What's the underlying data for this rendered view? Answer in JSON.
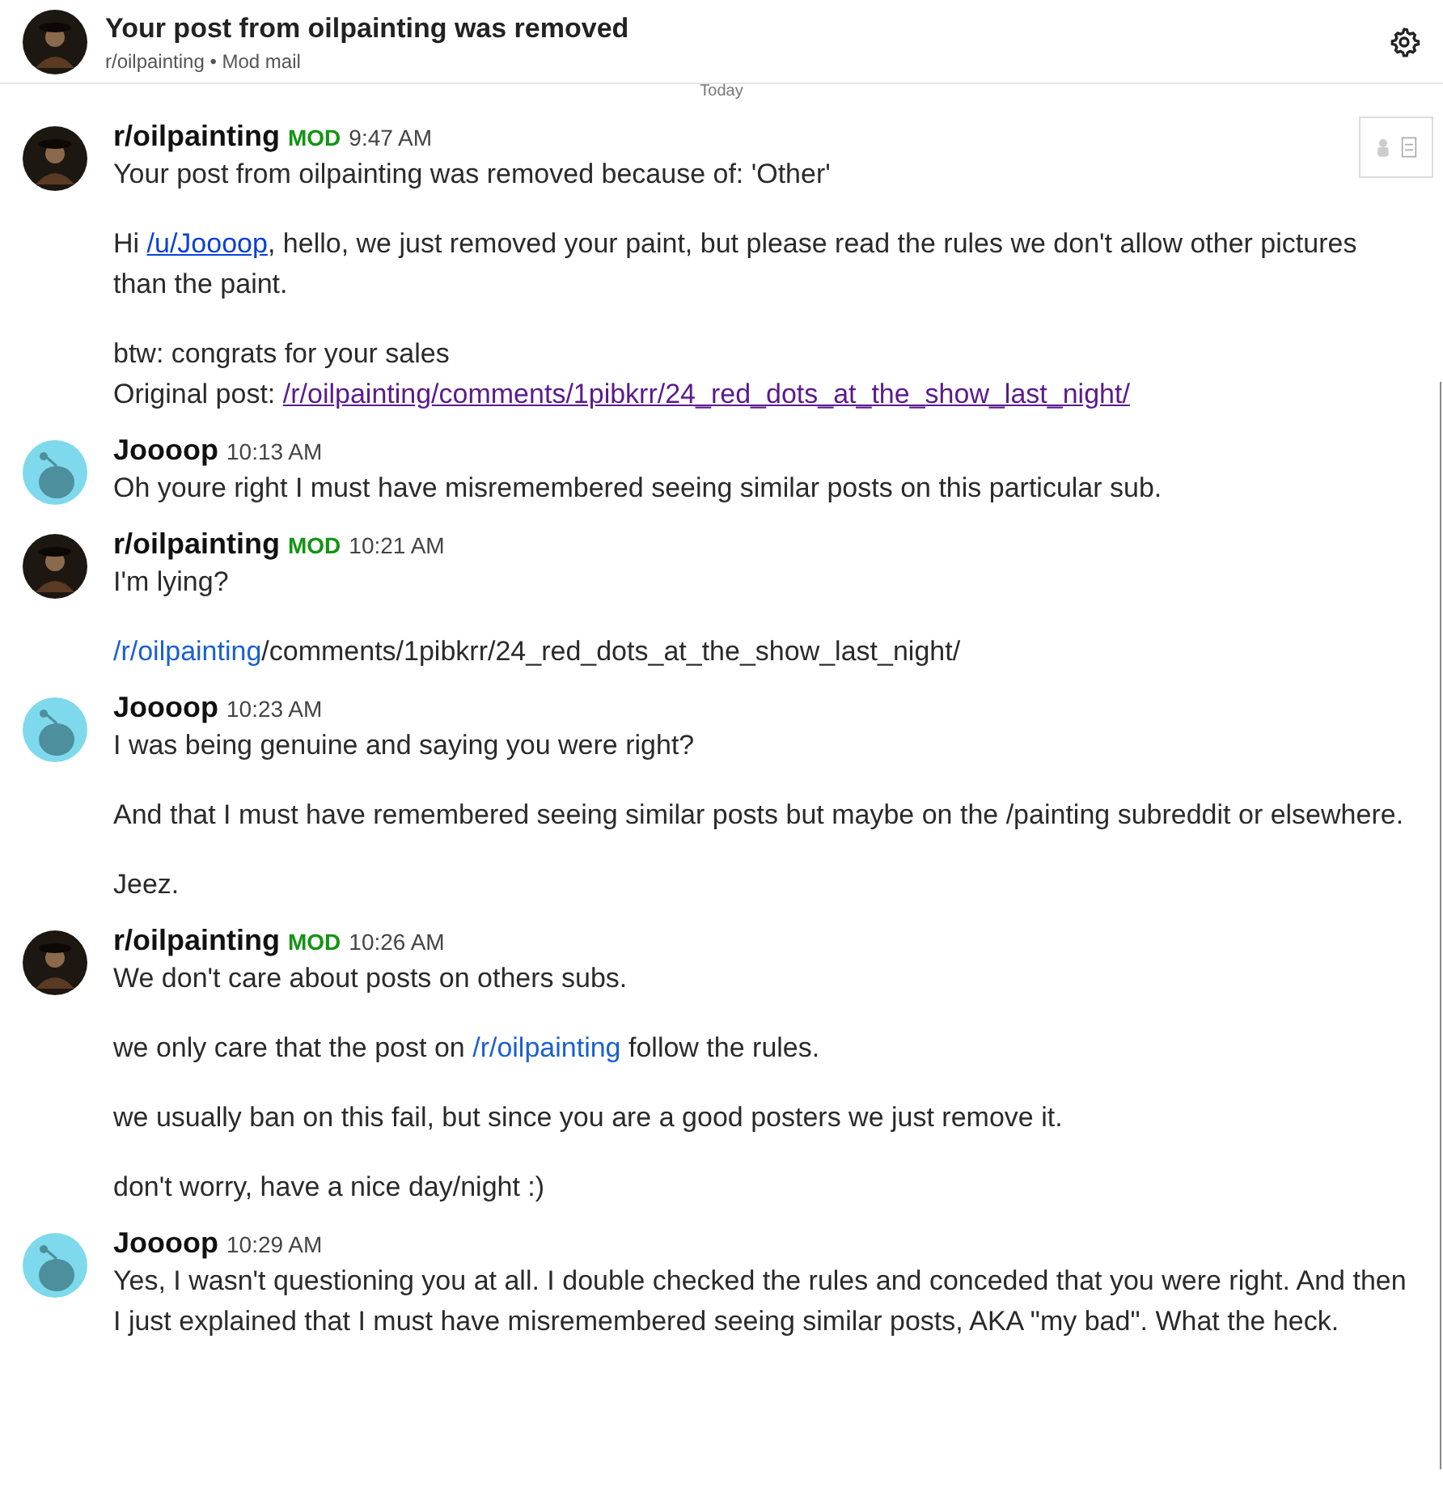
{
  "header": {
    "title": "Your post from oilpainting was removed",
    "subtitle": "r/oilpainting • Mod mail"
  },
  "divider": "Today",
  "messages": [
    {
      "author": "r/oilpainting",
      "kind": "mod",
      "badge": "MOD",
      "time": "9:47 AM",
      "attachment": true,
      "blocks": [
        [
          [
            {
              "kind": "text",
              "text": "Your post from oilpainting was removed because of: 'Other'"
            }
          ]
        ],
        [
          [
            {
              "kind": "text",
              "text": "Hi "
            },
            {
              "kind": "link",
              "text": "/u/Joooop"
            },
            {
              "kind": "text",
              "text": ", hello, we just removed your paint, but please read the rules we don't allow other pictures than the paint."
            }
          ]
        ],
        [
          [
            {
              "kind": "text",
              "text": "btw: congrats for your sales"
            }
          ],
          [
            {
              "kind": "text",
              "text": "Original post: "
            },
            {
              "kind": "visited",
              "text": "/r/oilpainting/comments/1pibkrr/24_red_dots_at_the_show_last_night/"
            }
          ]
        ]
      ]
    },
    {
      "author": "Joooop",
      "kind": "user",
      "time": "10:13 AM",
      "attachment": false,
      "blocks": [
        [
          [
            {
              "kind": "text",
              "text": "Oh youre right I must have misremembered seeing similar posts on this particular sub."
            }
          ]
        ]
      ]
    },
    {
      "author": "r/oilpainting",
      "kind": "mod",
      "badge": "MOD",
      "time": "10:21 AM",
      "attachment": false,
      "blocks": [
        [
          [
            {
              "kind": "text",
              "text": "I'm lying?"
            }
          ]
        ],
        [
          [
            {
              "kind": "plain",
              "text": "/r/oilpainting"
            },
            {
              "kind": "text",
              "text": "/comments/1pibkrr/24_red_dots_at_the_show_last_night/"
            }
          ]
        ]
      ]
    },
    {
      "author": "Joooop",
      "kind": "user",
      "time": "10:23 AM",
      "attachment": false,
      "blocks": [
        [
          [
            {
              "kind": "text",
              "text": "I was being genuine and saying you were right?"
            }
          ]
        ],
        [
          [
            {
              "kind": "text",
              "text": "And that I must have remembered seeing similar posts but maybe on the /painting subreddit or elsewhere."
            }
          ]
        ],
        [
          [
            {
              "kind": "text",
              "text": "Jeez."
            }
          ]
        ]
      ]
    },
    {
      "author": "r/oilpainting",
      "kind": "mod",
      "badge": "MOD",
      "time": "10:26 AM",
      "attachment": false,
      "blocks": [
        [
          [
            {
              "kind": "text",
              "text": "We don't care about posts on others subs."
            }
          ]
        ],
        [
          [
            {
              "kind": "text",
              "text": "we only care that the post on "
            },
            {
              "kind": "plain",
              "text": "/r/oilpainting"
            },
            {
              "kind": "text",
              "text": " follow the rules."
            }
          ]
        ],
        [
          [
            {
              "kind": "text",
              "text": "we usually ban on this fail, but since you are a good posters we just remove it."
            }
          ]
        ],
        [
          [
            {
              "kind": "text",
              "text": "don't worry, have a nice day/night :)"
            }
          ]
        ]
      ]
    },
    {
      "author": "Joooop",
      "kind": "user",
      "time": "10:29 AM",
      "attachment": false,
      "blocks": [
        [
          [
            {
              "kind": "text",
              "text": "Yes, I wasn't questioning you at all. I double checked the rules and conceded that you were right. And then I just explained that I must have misremembered seeing similar posts, AKA \"my bad\". What the heck."
            }
          ]
        ]
      ]
    }
  ]
}
